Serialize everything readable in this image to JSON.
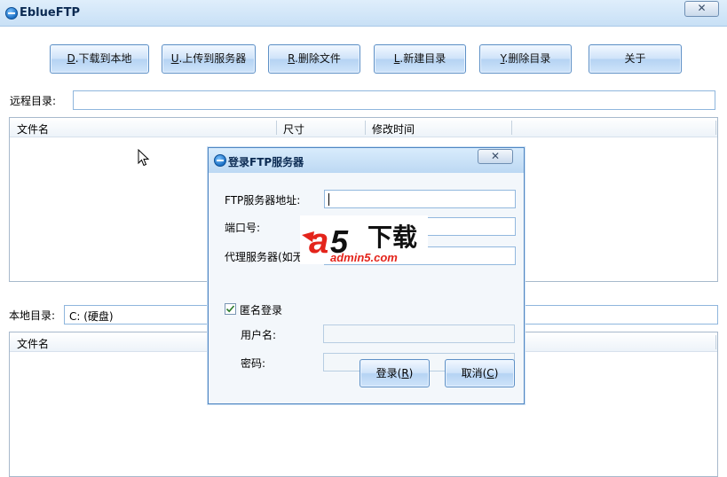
{
  "window": {
    "title": "EblueFTP",
    "close_glyph": "✕"
  },
  "toolbar": [
    {
      "hotkey": "D",
      "label": ".下载到本地"
    },
    {
      "hotkey": "U",
      "label": ".上传到服务器"
    },
    {
      "hotkey": "R",
      "label": ".删除文件"
    },
    {
      "hotkey": "L",
      "label": ".新建目录"
    },
    {
      "hotkey": "Y",
      "label": ".删除目录"
    },
    {
      "hotkey": "",
      "label": "关于"
    }
  ],
  "remote": {
    "label": "远程目录:",
    "path": "",
    "columns": [
      "文件名",
      "尺寸",
      "修改时间"
    ]
  },
  "local": {
    "label": "本地目录:",
    "drive": "C: (硬盘)",
    "columns": [
      "文件名"
    ]
  },
  "dialog": {
    "title": "登录FTP服务器",
    "close_glyph": "✕",
    "host_label": "FTP服务器地址:",
    "host_value": "",
    "port_label": "端口号:",
    "port_value": "",
    "proxy_label": "代理服务器(如无",
    "proxy_value": "",
    "anonymous_label": "匿名登录",
    "anonymous_checked": true,
    "username_label": "用户名:",
    "password_label": "密码:",
    "ok": {
      "label": "登录(",
      "hotkey": "R",
      "tail": ")"
    },
    "cancel": {
      "label": "取消(",
      "hotkey": "C",
      "tail": ")"
    }
  },
  "watermark": {
    "brand_a": "a",
    "brand_num": "5",
    "brand_cn": "下载",
    "site": "admin5.com"
  },
  "icons": {
    "app": "ebluftp-app-icon",
    "cursor": "mouse-pointer-icon",
    "check": "checkmark-icon"
  },
  "colors": {
    "accent": "#5e90c6",
    "titlebar": "#c8e0f6",
    "logo_red": "#e4241b"
  }
}
